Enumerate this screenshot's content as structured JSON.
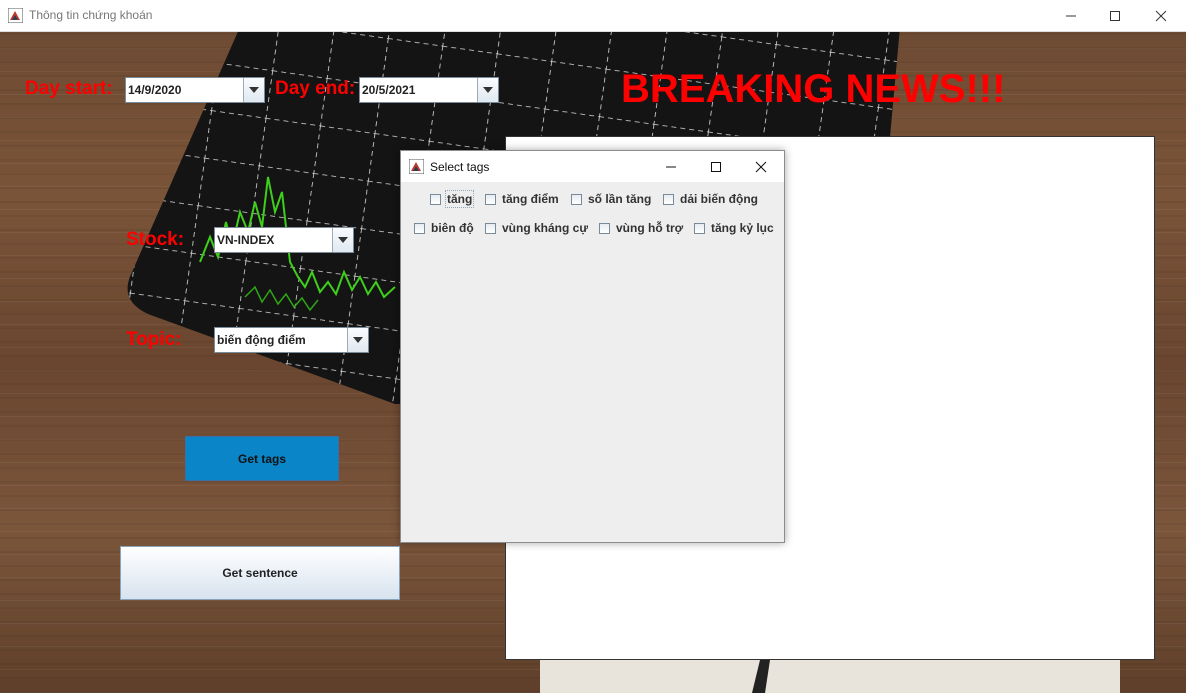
{
  "window": {
    "title": "Thông tin chứng khoán",
    "controls": [
      "minimize-icon",
      "maximize-icon",
      "close-icon"
    ]
  },
  "form": {
    "day_start_label": "Day start:",
    "day_start_value": "14/9/2020",
    "day_end_label": "Day end:",
    "day_end_value": "20/5/2021",
    "stock_label": "Stock:",
    "stock_value": "VN-INDEX",
    "topic_label": "Topic:",
    "topic_value": "biến động điểm",
    "get_tags_button": "Get tags",
    "get_sentence_button": "Get sentence"
  },
  "headline": "BREAKING NEWS!!!",
  "dialog": {
    "title": "Select tags",
    "tags": [
      {
        "label": "tăng",
        "checked": false
      },
      {
        "label": "tăng điểm",
        "checked": false
      },
      {
        "label": "số lần tăng",
        "checked": false
      },
      {
        "label": "dải biến động",
        "checked": false
      },
      {
        "label": "biên độ",
        "checked": false
      },
      {
        "label": "vùng kháng cự",
        "checked": false
      },
      {
        "label": "vùng hỗ trợ",
        "checked": false
      },
      {
        "label": "tăng kỷ lục",
        "checked": false
      }
    ]
  },
  "colors": {
    "label_red": "#ff0000",
    "get_tags_blue": "#0a86c8",
    "chart_green": "#3ecf1a"
  }
}
